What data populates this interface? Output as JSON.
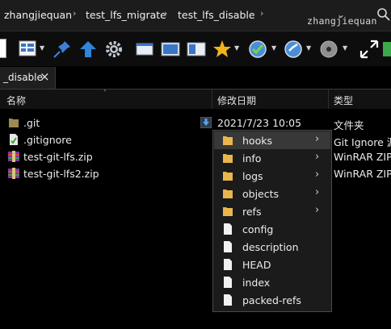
{
  "breadcrumb": [
    "zhangjiequan",
    "test_lfs_migrate",
    "test_lfs_disable"
  ],
  "search_text": "zhangjiequan",
  "tab": {
    "label": "_disable"
  },
  "columns": {
    "name": "名称",
    "date": "修改日期",
    "type": "类型"
  },
  "files": [
    {
      "name": ".git",
      "icon": "folder-icon",
      "date": "2021/7/23 10:05",
      "type": "文件夹"
    },
    {
      "name": ".gitignore",
      "icon": "gitignore-file-icon",
      "date": "",
      "type": "Git Ignore 源"
    },
    {
      "name": "test-git-lfs.zip",
      "icon": "winrar-zip-icon",
      "date": "",
      "type": "WinRAR ZIP"
    },
    {
      "name": "test-git-lfs2.zip",
      "icon": "winrar-zip-icon",
      "date": "",
      "type": "WinRAR ZIP"
    }
  ],
  "menu": {
    "items": [
      {
        "label": "hooks",
        "kind": "folder",
        "submenu": true
      },
      {
        "label": "info",
        "kind": "folder",
        "submenu": true
      },
      {
        "label": "logs",
        "kind": "folder",
        "submenu": true
      },
      {
        "label": "objects",
        "kind": "folder",
        "submenu": true
      },
      {
        "label": "refs",
        "kind": "folder",
        "submenu": true
      },
      {
        "label": "config",
        "kind": "file",
        "submenu": false
      },
      {
        "label": "description",
        "kind": "file",
        "submenu": false
      },
      {
        "label": "HEAD",
        "kind": "file",
        "submenu": false
      },
      {
        "label": "index",
        "kind": "file",
        "submenu": false
      },
      {
        "label": "packed-refs",
        "kind": "file",
        "submenu": false
      }
    ]
  },
  "colors": {
    "background": "#000000",
    "folder": "#e8b64c",
    "menu_bg": "#1b1b1b",
    "highlight": "#383838"
  }
}
